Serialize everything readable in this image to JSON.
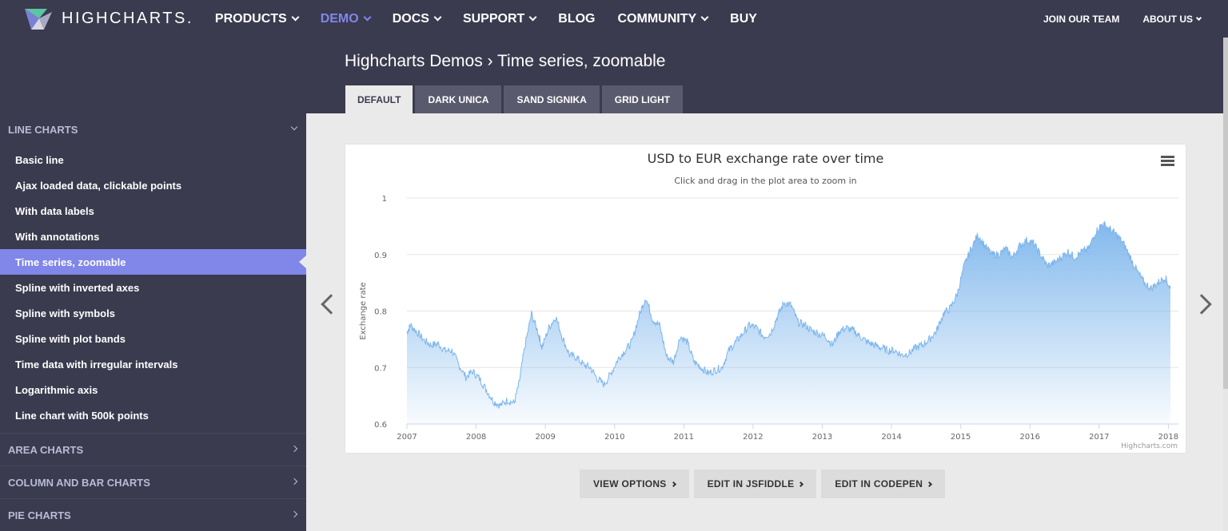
{
  "brand": {
    "name": "HIGHCHARTS."
  },
  "nav": {
    "items": [
      {
        "label": "PRODUCTS",
        "dropdown": true,
        "active": false
      },
      {
        "label": "DEMO",
        "dropdown": true,
        "active": true
      },
      {
        "label": "DOCS",
        "dropdown": true,
        "active": false
      },
      {
        "label": "SUPPORT",
        "dropdown": true,
        "active": false
      },
      {
        "label": "BLOG",
        "dropdown": false,
        "active": false
      },
      {
        "label": "COMMUNITY",
        "dropdown": true,
        "active": false
      },
      {
        "label": "BUY",
        "dropdown": false,
        "active": false
      }
    ],
    "right": [
      {
        "label": "JOIN OUR TEAM",
        "dropdown": false
      },
      {
        "label": "ABOUT US",
        "dropdown": true
      }
    ]
  },
  "page": {
    "title": "Highcharts Demos › Time series, zoomable"
  },
  "tabs": [
    "DEFAULT",
    "DARK UNICA",
    "SAND SIGNIKA",
    "GRID LIGHT"
  ],
  "sidebar": {
    "open_group": "LINE CHARTS",
    "items": [
      "Basic line",
      "Ajax loaded data, clickable points",
      "With data labels",
      "With annotations",
      "Time series, zoomable",
      "Spline with inverted axes",
      "Spline with symbols",
      "Spline with plot bands",
      "Time data with irregular intervals",
      "Logarithmic axis",
      "Line chart with 500k points"
    ],
    "active_item": "Time series, zoomable",
    "groups": [
      "AREA CHARTS",
      "COLUMN AND BAR CHARTS",
      "PIE CHARTS"
    ]
  },
  "buttons": [
    "VIEW OPTIONS",
    "EDIT IN JSFIDDLE",
    "EDIT IN CODEPEN"
  ],
  "colors": {
    "nav_bg": "#3b3b4f",
    "accent": "#8087e8",
    "series": "#7cb5ec"
  },
  "chart_data": {
    "type": "area",
    "title": "USD to EUR exchange rate over time",
    "subtitle": "Click and drag in the plot area to zoom in",
    "ylabel": "Exchange rate",
    "xlabel": "",
    "credits": "Highcharts.com",
    "ylim": [
      0.6,
      1.0
    ],
    "yticks": [
      0.6,
      0.7,
      0.8,
      0.9,
      1
    ],
    "xlim": [
      2007.0,
      2018.03
    ],
    "xticks": [
      2007,
      2008,
      2009,
      2010,
      2011,
      2012,
      2013,
      2014,
      2015,
      2016,
      2017,
      2018
    ],
    "grid": true,
    "legend": "none",
    "series": [
      {
        "x": [
          2007.0,
          2007.05,
          2007.15,
          2007.25,
          2007.35,
          2007.45,
          2007.55,
          2007.65,
          2007.75,
          2007.85,
          2007.95,
          2008.05,
          2008.15,
          2008.25,
          2008.35,
          2008.45,
          2008.55,
          2008.62,
          2008.7,
          2008.8,
          2008.9,
          2008.95,
          2009.05,
          2009.15,
          2009.25,
          2009.35,
          2009.45,
          2009.55,
          2009.65,
          2009.75,
          2009.85,
          2009.95,
          2010.05,
          2010.15,
          2010.25,
          2010.35,
          2010.45,
          2010.55,
          2010.65,
          2010.75,
          2010.85,
          2010.95,
          2011.05,
          2011.15,
          2011.25,
          2011.35,
          2011.45,
          2011.55,
          2011.65,
          2011.75,
          2011.85,
          2011.95,
          2012.05,
          2012.15,
          2012.25,
          2012.35,
          2012.45,
          2012.55,
          2012.65,
          2012.75,
          2012.85,
          2012.95,
          2013.05,
          2013.15,
          2013.25,
          2013.35,
          2013.45,
          2013.55,
          2013.65,
          2013.75,
          2013.85,
          2013.95,
          2014.05,
          2014.15,
          2014.25,
          2014.35,
          2014.45,
          2014.55,
          2014.65,
          2014.75,
          2014.85,
          2014.95,
          2015.05,
          2015.15,
          2015.25,
          2015.35,
          2015.45,
          2015.55,
          2015.65,
          2015.75,
          2015.85,
          2015.95,
          2016.05,
          2016.15,
          2016.25,
          2016.35,
          2016.45,
          2016.55,
          2016.65,
          2016.75,
          2016.85,
          2016.95,
          2017.05,
          2017.15,
          2017.25,
          2017.35,
          2017.45,
          2017.55,
          2017.65,
          2017.75,
          2017.85,
          2017.95,
          2018.03
        ],
        "y": [
          0.762,
          0.775,
          0.762,
          0.748,
          0.74,
          0.742,
          0.73,
          0.73,
          0.705,
          0.683,
          0.693,
          0.68,
          0.66,
          0.64,
          0.633,
          0.642,
          0.637,
          0.672,
          0.735,
          0.795,
          0.76,
          0.735,
          0.77,
          0.79,
          0.752,
          0.722,
          0.718,
          0.705,
          0.7,
          0.68,
          0.67,
          0.69,
          0.715,
          0.73,
          0.745,
          0.79,
          0.825,
          0.785,
          0.775,
          0.72,
          0.71,
          0.755,
          0.745,
          0.71,
          0.7,
          0.69,
          0.695,
          0.7,
          0.73,
          0.745,
          0.76,
          0.775,
          0.77,
          0.755,
          0.76,
          0.79,
          0.815,
          0.81,
          0.78,
          0.775,
          0.765,
          0.76,
          0.755,
          0.74,
          0.765,
          0.77,
          0.765,
          0.755,
          0.745,
          0.74,
          0.735,
          0.73,
          0.73,
          0.722,
          0.725,
          0.735,
          0.74,
          0.75,
          0.765,
          0.795,
          0.805,
          0.83,
          0.88,
          0.91,
          0.935,
          0.915,
          0.9,
          0.9,
          0.91,
          0.895,
          0.915,
          0.925,
          0.92,
          0.9,
          0.88,
          0.885,
          0.895,
          0.905,
          0.895,
          0.905,
          0.91,
          0.94,
          0.955,
          0.945,
          0.935,
          0.92,
          0.895,
          0.87,
          0.85,
          0.84,
          0.85,
          0.86,
          0.84
        ]
      }
    ]
  }
}
